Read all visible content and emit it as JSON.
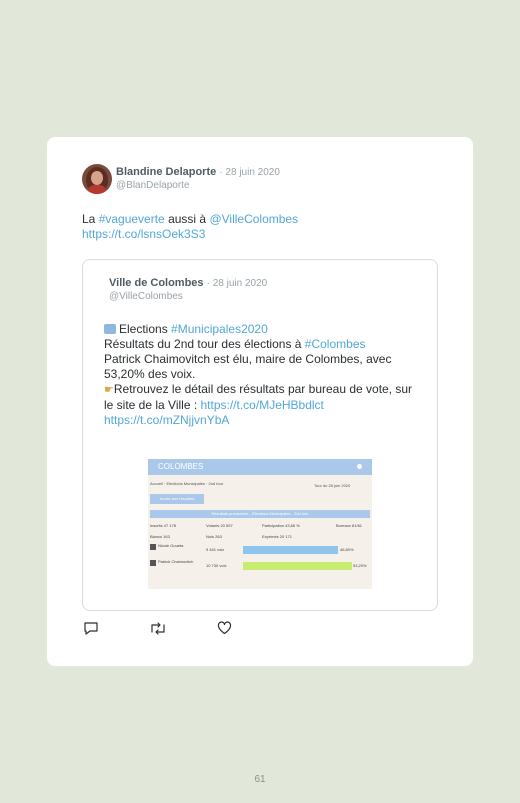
{
  "tweet": {
    "author_name": "Blandine Delaporte",
    "date": "· 28 juin 2020",
    "handle": "@BlanDelaporte",
    "text_prefix": "La ",
    "hashtag": "#vagueverte",
    "text_middle": " aussi à ",
    "mention": "@VilleColombes",
    "link": "https://t.co/lsnsOek3S3"
  },
  "quoted": {
    "author_name": "Ville de Colombes",
    "date": "· 28 juin 2020",
    "handle": "@VilleColombes",
    "line1_prefix": "Elections ",
    "line1_hashtag": "#Municipales2020",
    "line2_prefix": "Résultats du 2nd tour des élections à ",
    "line2_hashtag": "#Colombes",
    "line3": "Patrick Chaimovitch est élu, maire de Colombes, avec 53,20% des voix.",
    "line4": "Retrouvez le détail des résultats par bureau de vote, sur le site de la Ville : ",
    "link1": "https://t.co/MJeHBbdlct",
    "link2": "https://t.co/mZNjjvnYbA",
    "embedded_image": {
      "header": "COLOMBES",
      "subtitle": "Accueil · Elections Municipales · 2nd tour",
      "date": "Tour du 28 juin 2020",
      "button": "Accès aux résultats",
      "band": "Résultats provisoires - Élections Municipales - 2nd tour",
      "stats": [
        "Inscrits 47 178",
        "Votants 20 597",
        "Participation 43,66 %",
        "Bureaux 61/61",
        "Blancs 163",
        "Nuls 263",
        "Exprimés 20 171",
        "Abstention 56,34 %"
      ],
      "candidates": [
        {
          "name": "Nicole Goueta",
          "votes": "9 441 voix",
          "pct": "46,80%"
        },
        {
          "name": "Patrick Chaimovitch",
          "votes": "10 730 voix",
          "pct": "53,20%"
        }
      ]
    }
  },
  "actions": {
    "reply": "reply-icon",
    "retweet": "retweet-icon",
    "like": "heart-icon"
  },
  "page_number": "61"
}
